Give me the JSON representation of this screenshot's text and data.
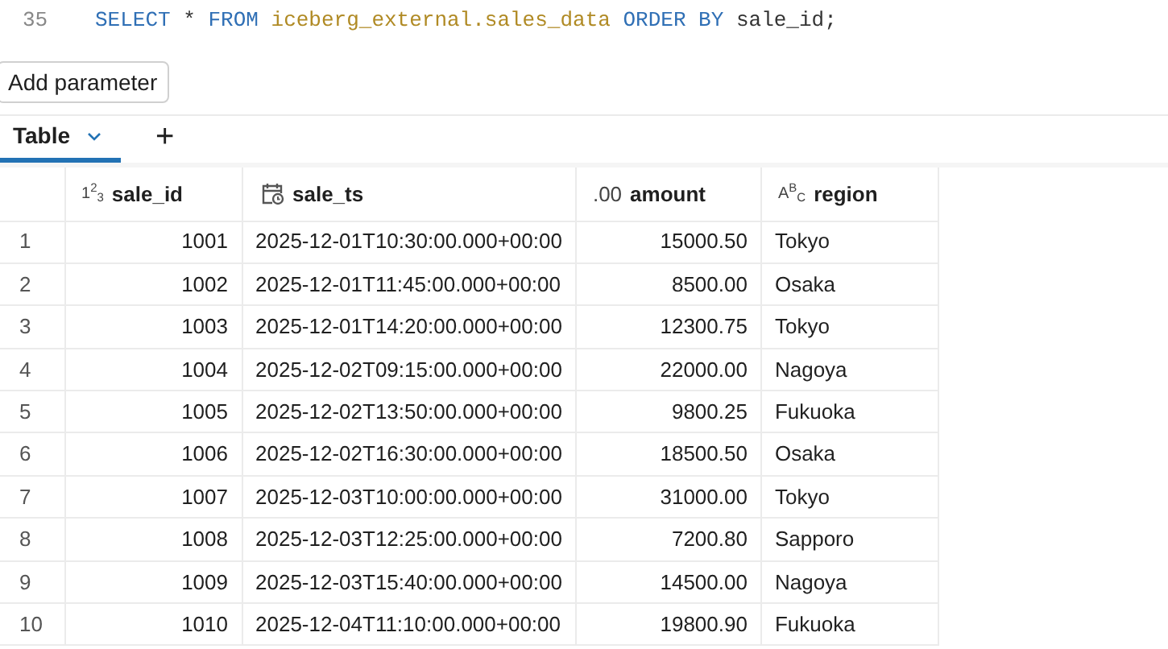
{
  "editor": {
    "line_number": "35",
    "tokens": [
      {
        "kind": "keyword",
        "text": "SELECT"
      },
      {
        "kind": "plain",
        "text": "*"
      },
      {
        "kind": "keyword",
        "text": "FROM"
      },
      {
        "kind": "identifier",
        "text": "iceberg_external.sales_data"
      },
      {
        "kind": "keyword",
        "text": "ORDER BY"
      },
      {
        "kind": "plain",
        "text": "sale_id;"
      }
    ]
  },
  "add_parameter_button": "Add parameter",
  "tabs": [
    {
      "label": "Table",
      "selected": true
    }
  ],
  "add_tab": "+",
  "table": {
    "columns": [
      {
        "name": "sale_id",
        "kind": "integer",
        "type_mark": "1$^{2}$$_{3}$"
      },
      {
        "name": "sale_ts",
        "kind": "timestamp"
      },
      {
        "name": "amount",
        "kind": "decimal",
        "type_mark": ".00"
      },
      {
        "name": "region",
        "kind": "string",
        "type_mark": "A$^{B}$$_{C}$"
      }
    ],
    "rows": [
      {
        "index": "1",
        "cells": [
          "1001",
          "2025-12-01T10:30:00.000+00:00",
          "15000.50",
          "Tokyo"
        ]
      },
      {
        "index": "2",
        "cells": [
          "1002",
          "2025-12-01T11:45:00.000+00:00",
          "8500.00",
          "Osaka"
        ]
      },
      {
        "index": "3",
        "cells": [
          "1003",
          "2025-12-01T14:20:00.000+00:00",
          "12300.75",
          "Tokyo"
        ]
      },
      {
        "index": "4",
        "cells": [
          "1004",
          "2025-12-02T09:15:00.000+00:00",
          "22000.00",
          "Nagoya"
        ]
      },
      {
        "index": "5",
        "cells": [
          "1005",
          "2025-12-02T13:50:00.000+00:00",
          "9800.25",
          "Fukuoka"
        ]
      },
      {
        "index": "6",
        "cells": [
          "1006",
          "2025-12-02T16:30:00.000+00:00",
          "18500.50",
          "Osaka"
        ]
      },
      {
        "index": "7",
        "cells": [
          "1007",
          "2025-12-03T10:00:00.000+00:00",
          "31000.00",
          "Tokyo"
        ]
      },
      {
        "index": "8",
        "cells": [
          "1008",
          "2025-12-03T12:25:00.000+00:00",
          "7200.80",
          "Sapporo"
        ]
      },
      {
        "index": "9",
        "cells": [
          "1009",
          "2025-12-03T15:40:00.000+00:00",
          "14500.00",
          "Nagoya"
        ]
      },
      {
        "index": "10",
        "cells": [
          "1010",
          "2025-12-04T11:10:00.000+00:00",
          "19800.90",
          "Fukuoka"
        ]
      }
    ]
  }
}
